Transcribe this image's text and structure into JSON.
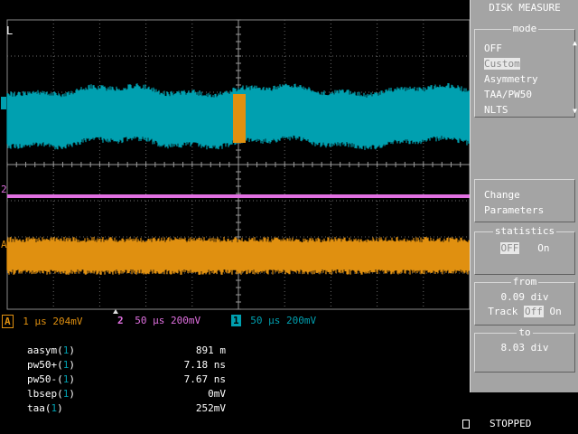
{
  "grid": {
    "marker": "L"
  },
  "channels": {
    "ch1": {
      "id": "1",
      "color": "#00a0b0",
      "timebase": "50 μs",
      "scale": "200mV"
    },
    "ch2": {
      "id": "2",
      "color": "#e070e0",
      "timebase": "50 μs",
      "scale": "200mV"
    },
    "chA": {
      "id": "A",
      "color": "#e09010",
      "timebase": "1 μs",
      "scale": "204mV"
    }
  },
  "measurements": [
    {
      "name": "aasym(",
      "src": "1",
      "close": ")",
      "value": "891 m"
    },
    {
      "name": "pw50+(",
      "src": "1",
      "close": ")",
      "value": "7.18 ns"
    },
    {
      "name": "pw50-(",
      "src": "1",
      "close": ")",
      "value": "7.67 ns"
    },
    {
      "name": "lbsep(",
      "src": "1",
      "close": ")",
      "value": "0mV"
    },
    {
      "name": "taa(",
      "src": "1",
      "close": ")",
      "value": "252mV"
    }
  ],
  "status": {
    "text": "STOPPED"
  },
  "menu": {
    "title": "DISK MEASURE",
    "mode": {
      "legend": "mode",
      "options": [
        "OFF",
        "Custom",
        "Asymmetry",
        "TAA/PW50",
        "NLTS"
      ],
      "selected_index": 1
    },
    "change": {
      "line1": "Change",
      "line2": "Parameters"
    },
    "statistics": {
      "legend": "statistics",
      "off": "OFF",
      "on": "On",
      "state": "OFF"
    },
    "from": {
      "legend": "from",
      "value": "0.09 div",
      "track_label": "Track",
      "off": "Off",
      "on": "On"
    },
    "to": {
      "legend": "to",
      "value": "8.03 div"
    }
  }
}
